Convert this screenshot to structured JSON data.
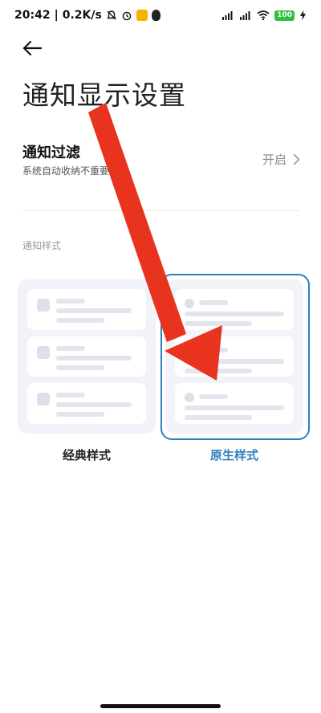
{
  "status_bar": {
    "time": "20:42",
    "net_speed": "0.2K/s",
    "battery": "100",
    "signal_label": "HD"
  },
  "page": {
    "title": "通知显示设置"
  },
  "notification_filter": {
    "title": "通知过滤",
    "description": "系统自动收纳不重要通知",
    "state": "开启"
  },
  "notification_style": {
    "section_label": "通知样式",
    "options": [
      {
        "label": "经典样式",
        "selected": false
      },
      {
        "label": "原生样式",
        "selected": true
      }
    ]
  },
  "colors": {
    "accent": "#2e7fbd",
    "annotation_arrow": "#e8331f"
  },
  "icons": [
    "back-arrow-icon",
    "chevron-right-icon",
    "mute-icon",
    "alarm-icon",
    "wifi-icon",
    "battery-icon",
    "charging-icon"
  ]
}
